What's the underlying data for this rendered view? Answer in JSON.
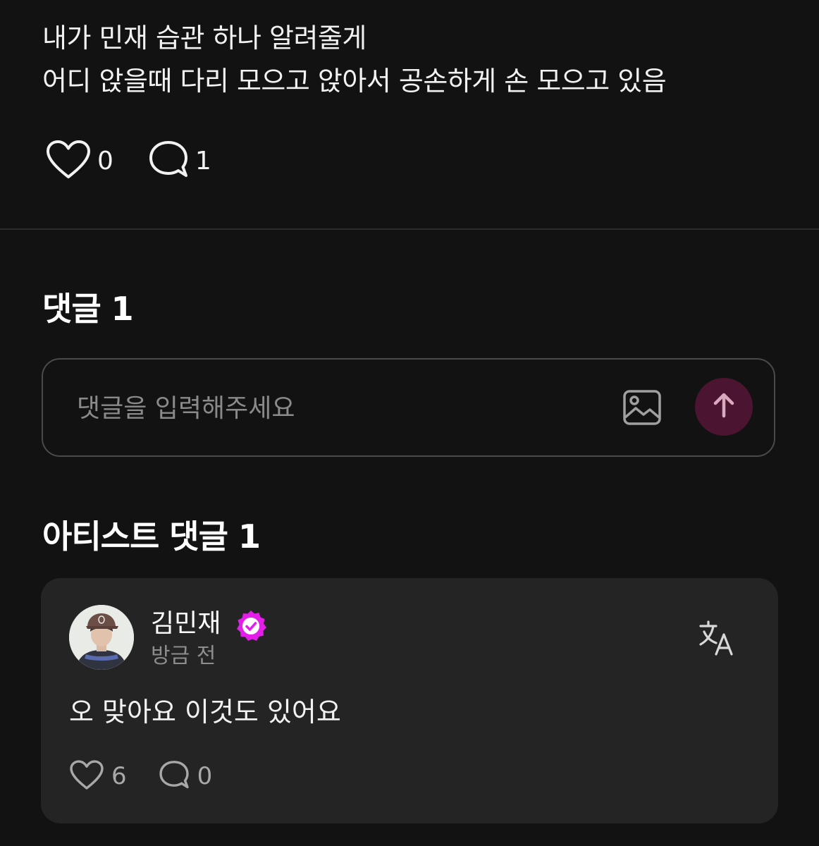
{
  "post": {
    "lines": [
      "내가 민재 습관 하나 알려줄게",
      "어디 앉을때 다리 모으고 앉아서 공손하게 손 모으고 있음"
    ],
    "like_count": "0",
    "comment_count": "1"
  },
  "comments_section": {
    "title": "댓글 1",
    "input_placeholder": "댓글을 입력해주세요"
  },
  "artist_comments": {
    "title": "아티스트 댓글 1",
    "items": [
      {
        "author": "김민재",
        "time": "방금 전",
        "text": "오 맞아요 이것도 있어요",
        "like_count": "6",
        "comment_count": "0"
      }
    ]
  },
  "icons": {
    "like": "heart-outline-icon",
    "comment": "speech-bubble-icon",
    "image": "image-icon",
    "send": "arrow-up-icon",
    "verified": "verified-badge-icon",
    "translate": "translate-icon"
  },
  "colors": {
    "background": "#121212",
    "card": "#242424",
    "accent_send": "#4b1430",
    "verified": "#e21ee8"
  }
}
